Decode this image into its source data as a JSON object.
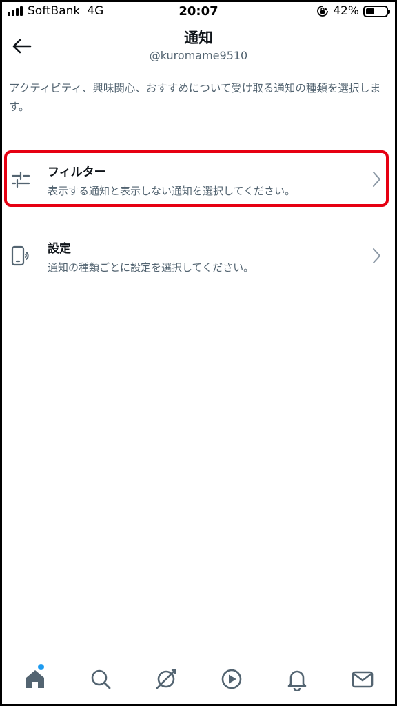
{
  "status_bar": {
    "carrier": "SoftBank",
    "network": "4G",
    "time": "20:07",
    "battery_percent": "42%",
    "battery_level": 0.42,
    "icons": [
      "signal-icon",
      "orientation-lock-icon",
      "battery-icon"
    ]
  },
  "header": {
    "title": "通知",
    "username": "@kuromame9510",
    "back_icon": "back-arrow-icon"
  },
  "description": "アクティビティ、興味関心、おすすめについて受け取る通知の種類を選択します。",
  "items": [
    {
      "title": "フィルター",
      "subtitle": "表示する通知と表示しない通知を選択してください。",
      "icon": "filter-sliders-icon",
      "highlighted": true
    },
    {
      "title": "設定",
      "subtitle": "通知の種類ごとに設定を選択してください。",
      "icon": "device-icon",
      "highlighted": false
    }
  ],
  "tabbar": {
    "tabs": [
      "home-icon",
      "search-icon",
      "spaces-icon",
      "video-icon",
      "notifications-icon",
      "messages-icon"
    ],
    "badge_on": "home"
  },
  "colors": {
    "highlight": "#e60012",
    "text_primary": "#0f1419",
    "text_secondary": "#536471",
    "accent": "#1d9bf0",
    "icon_gray": "#536471"
  }
}
